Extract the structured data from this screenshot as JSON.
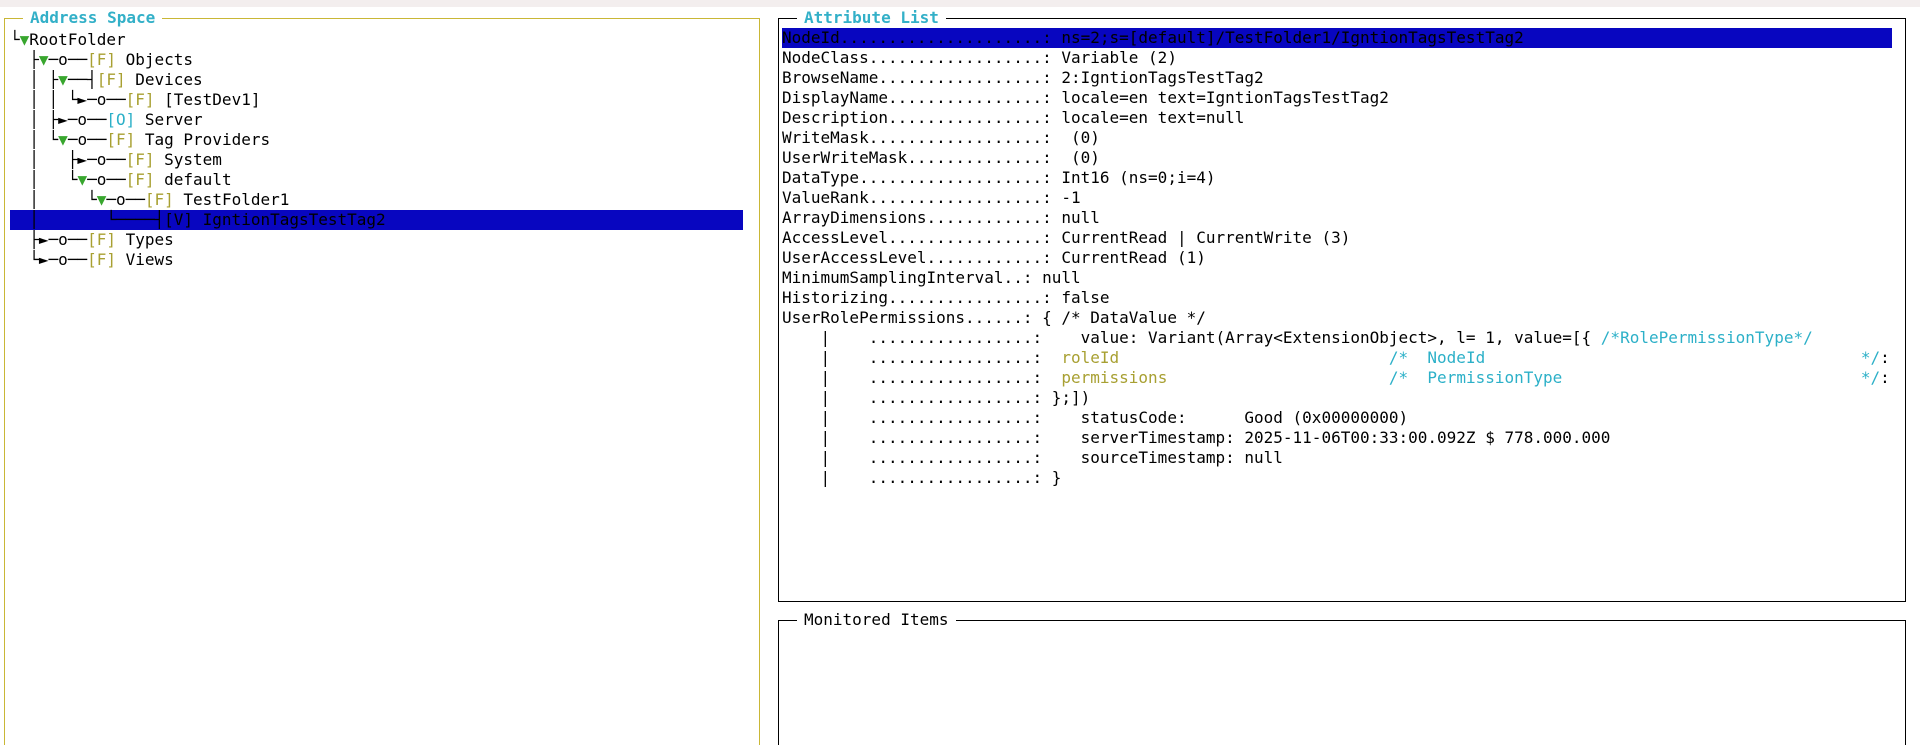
{
  "colors": {
    "address_border": "#c9b736",
    "title_cyan": "#33b0c8",
    "selection_blue": "#0806c0",
    "tree_green": "#38a62e",
    "folder_olive": "#a8a032",
    "object_cyan": "#2cb0c8"
  },
  "address_space": {
    "title": "Address Space",
    "tree": [
      {
        "id": "rootfolder",
        "segments": [
          {
            "t": "└"
          },
          {
            "t": "▼",
            "c": "g"
          },
          {
            "t": "RootFolder"
          }
        ]
      },
      {
        "id": "objects",
        "segments": [
          {
            "t": "  ├"
          },
          {
            "t": "▼",
            "c": "g"
          },
          {
            "t": "─o──"
          },
          {
            "t": "[F]",
            "c": "f"
          },
          {
            "t": " Objects"
          }
        ]
      },
      {
        "id": "devices",
        "segments": [
          {
            "t": "  │ ├"
          },
          {
            "t": "▼",
            "c": "g"
          },
          {
            "t": "──┤"
          },
          {
            "t": "[F]",
            "c": "f"
          },
          {
            "t": " Devices"
          }
        ]
      },
      {
        "id": "testdev1",
        "segments": [
          {
            "t": "  │ │ └►─o──"
          },
          {
            "t": "[F]",
            "c": "f"
          },
          {
            "t": " [TestDev1]"
          }
        ]
      },
      {
        "id": "server",
        "segments": [
          {
            "t": "  │ ├►─o──"
          },
          {
            "t": "[O]",
            "c": "c"
          },
          {
            "t": " Server"
          }
        ]
      },
      {
        "id": "tag-providers",
        "segments": [
          {
            "t": "  │ └"
          },
          {
            "t": "▼",
            "c": "g"
          },
          {
            "t": "─o──"
          },
          {
            "t": "[F]",
            "c": "f"
          },
          {
            "t": " Tag Providers"
          }
        ]
      },
      {
        "id": "system",
        "segments": [
          {
            "t": "  │   ├►─o──"
          },
          {
            "t": "[F]",
            "c": "f"
          },
          {
            "t": " System"
          }
        ]
      },
      {
        "id": "default",
        "segments": [
          {
            "t": "  │   └"
          },
          {
            "t": "▼",
            "c": "g"
          },
          {
            "t": "─o──"
          },
          {
            "t": "[F]",
            "c": "f"
          },
          {
            "t": " default"
          }
        ]
      },
      {
        "id": "testfolder1",
        "segments": [
          {
            "t": "  │     └"
          },
          {
            "t": "▼",
            "c": "g"
          },
          {
            "t": "─o──"
          },
          {
            "t": "[F]",
            "c": "f"
          },
          {
            "t": " TestFolder1"
          }
        ]
      },
      {
        "id": "igntiontagstesttag2",
        "selected": true,
        "segments": [
          {
            "t": "  │       └────┤[V] IgntionTagsTestTag2"
          }
        ]
      },
      {
        "id": "types",
        "segments": [
          {
            "t": "  ├►─o──"
          },
          {
            "t": "[F]",
            "c": "f"
          },
          {
            "t": " Types"
          }
        ]
      },
      {
        "id": "views",
        "segments": [
          {
            "t": "  └►─o──"
          },
          {
            "t": "[F]",
            "c": "f"
          },
          {
            "t": " Views"
          }
        ]
      }
    ]
  },
  "attribute_list": {
    "title": "Attribute List",
    "rows": [
      {
        "id": "nodeid",
        "selected": true,
        "segments": [
          {
            "t": "NodeId.....................: ns=2;s=[default]/TestFolder1/IgntionTagsTestTag2"
          }
        ]
      },
      {
        "id": "nodeclass",
        "segments": [
          {
            "t": "NodeClass..................: Variable (2)"
          }
        ]
      },
      {
        "id": "browsename",
        "segments": [
          {
            "t": "BrowseName.................: 2:IgntionTagsTestTag2"
          }
        ]
      },
      {
        "id": "displayname",
        "segments": [
          {
            "t": "DisplayName................: locale=en text=IgntionTagsTestTag2"
          }
        ]
      },
      {
        "id": "description",
        "segments": [
          {
            "t": "Description................: locale=en text=null"
          }
        ]
      },
      {
        "id": "writemask",
        "segments": [
          {
            "t": "WriteMask..................:  (0)"
          }
        ]
      },
      {
        "id": "userwritemask",
        "segments": [
          {
            "t": "UserWriteMask..............:  (0)"
          }
        ]
      },
      {
        "id": "datatype",
        "segments": [
          {
            "t": "DataType...................: Int16 (ns=0;i=4)"
          }
        ]
      },
      {
        "id": "valuerank",
        "segments": [
          {
            "t": "ValueRank..................: -1"
          }
        ]
      },
      {
        "id": "arraydimensions",
        "segments": [
          {
            "t": "ArrayDimensions............: null"
          }
        ]
      },
      {
        "id": "accesslevel",
        "segments": [
          {
            "t": "AccessLevel................: CurrentRead | CurrentWrite (3)"
          }
        ]
      },
      {
        "id": "useraccesslevel",
        "segments": [
          {
            "t": "UserAccessLevel............: CurrentRead (1)"
          }
        ]
      },
      {
        "id": "minimumsamplinginterval",
        "segments": [
          {
            "t": "MinimumSamplingInterval..: null"
          }
        ]
      },
      {
        "id": "historizing",
        "segments": [
          {
            "t": "Historizing................: false"
          }
        ]
      },
      {
        "id": "userrolepermissions",
        "segments": [
          {
            "t": "UserRolePermissions......: { /* DataValue */"
          }
        ]
      },
      {
        "id": "urp-value",
        "segments": [
          {
            "t": "    |    .................:    value: Variant(Array<ExtensionObject>, l= 1, value=[{ "
          },
          {
            "t": "/*RolePermissionType*/",
            "c": "c"
          }
        ]
      },
      {
        "id": "urp-roleid",
        "segments": [
          {
            "t": "    |    .................:  "
          },
          {
            "t": "roleId",
            "c": "f"
          },
          {
            "t": "                            "
          },
          {
            "t": "/*  NodeId                                       */",
            "c": "c"
          },
          {
            "t": ":"
          }
        ]
      },
      {
        "id": "urp-permissions",
        "segments": [
          {
            "t": "    |    .................:  "
          },
          {
            "t": "permissions",
            "c": "f"
          },
          {
            "t": "                       "
          },
          {
            "t": "/*  PermissionType                               */",
            "c": "c"
          },
          {
            "t": ":"
          }
        ]
      },
      {
        "id": "urp-close",
        "segments": [
          {
            "t": "    |    .................: };])"
          }
        ]
      },
      {
        "id": "urp-statuscode",
        "segments": [
          {
            "t": "    |    .................:    statusCode:      Good (0x00000000)"
          }
        ]
      },
      {
        "id": "urp-servertimestamp",
        "segments": [
          {
            "t": "    |    .................:    serverTimestamp: 2025-11-06T00:33:00.092Z $ 778.000.000"
          }
        ]
      },
      {
        "id": "urp-sourcetimestamp",
        "segments": [
          {
            "t": "    |    .................:    sourceTimestamp: null"
          }
        ]
      },
      {
        "id": "urp-end",
        "segments": [
          {
            "t": "    |    .................: }"
          }
        ]
      }
    ]
  },
  "monitored_items": {
    "title": "Monitored Items"
  }
}
